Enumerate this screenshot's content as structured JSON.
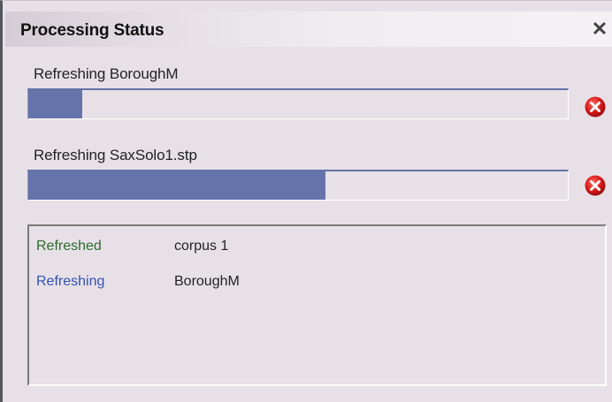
{
  "window": {
    "title": "Processing Status",
    "close_glyph": "✕"
  },
  "tasks": [
    {
      "label": "Refreshing BoroughM",
      "progress": 0.1,
      "cancel_icon": "cancel-icon"
    },
    {
      "label": "Refreshing SaxSolo1.stp",
      "progress": 0.55,
      "cancel_icon": "cancel-icon"
    }
  ],
  "log": {
    "rows": [
      {
        "status": "Refreshed",
        "name": "corpus 1"
      },
      {
        "status": "Refreshing",
        "name": "BoroughM"
      }
    ]
  },
  "colors": {
    "progress_fill": "#6473aa",
    "refreshed_text": "#2f6b2f",
    "refreshing_text": "#3550b0",
    "cancel_red": "#d91a1a"
  }
}
